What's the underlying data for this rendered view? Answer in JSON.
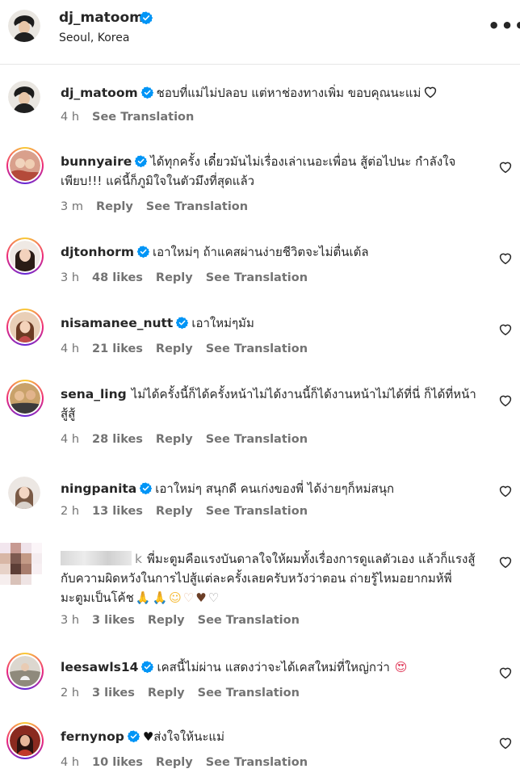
{
  "post": {
    "username": "dj_matoom",
    "location": "Seoul, Korea",
    "more_icon": "more-horizontal-icon"
  },
  "comments": [
    {
      "username": "dj_matoom",
      "text": "ชอบที่แม่ไม่ปลอบ แต่หาช่องทางเพิ่ม ขอบคุณนะแม่",
      "time": "4 h",
      "translate": "See Translation"
    },
    {
      "username": "bunnyaire",
      "text": "ได้ทุกครั้ง เดี๋ยวมันไม่เรื่องเล่าเนอะเพื่อน สู้ต่อไปนะ กำลังใจเพียบ!!! แค่นี้ก็ภูมิใจในตัวมึงที่สุดแล้ว",
      "time": "3 m",
      "reply": "Reply",
      "translate": "See Translation"
    },
    {
      "username": "djtonhorm",
      "text": "เอาใหม่ๆ ถ้าแคสผ่านง่ายชีวิตจะไม่ตื่นเต้ล",
      "time": "3 h",
      "likes": "48 likes",
      "reply": "Reply",
      "translate": "See Translation"
    },
    {
      "username": "nisamanee_nutt",
      "text": "เอาใหม่ๆมัม",
      "time": "4 h",
      "likes": "21 likes",
      "reply": "Reply",
      "translate": "See Translation"
    },
    {
      "username": "sena_ling",
      "text": "ไม่ได้ครั้งนี้ก็ได้ครั้งหน้าไม่ได้งานนี้ก็ได้งานหน้าไม่ได้ที่นี่ ก็ได้ที่หน้าสู้สู้",
      "time": "4 h",
      "likes": "28 likes",
      "reply": "Reply",
      "translate": "See Translation"
    },
    {
      "username": "ningpanita",
      "text": "เอาใหม่ๆ สนุกดี คนเก่งของพี่ ได้ง่ายๆก็หม่สนุก",
      "time": "2 h",
      "likes": "13 likes",
      "reply": "Reply",
      "translate": "See Translation"
    },
    {
      "username": "k",
      "text": "พี่มะตูมคือแรงบันดาลใจให้ผมทั้งเรื่องการดูแลตัวเอง แล้วก็แรงสู้กับความผิดหวังในการไปสู้แต่ละครั้งเลยครับหวังว่าตอน ถ่ายรู้ไหมอยากมห้พี่มะตูมเป็นโค้ช",
      "time": "3 h",
      "likes": "3 likes",
      "reply": "Reply",
      "translate": "See Translation"
    },
    {
      "username": "leesawls14",
      "text": "เคสนี้ไม่ผ่าน แสดงว่าจะได้เคสใหม่ที่ใหญ่กว่า",
      "time": "2 h",
      "likes": "3 likes",
      "reply": "Reply",
      "translate": "See Translation"
    },
    {
      "username": "fernynop",
      "text": "ส่งใจให้นะแม่",
      "time": "4 h",
      "likes": "10 likes",
      "reply": "Reply",
      "translate": "See Translation"
    }
  ],
  "colors": {
    "verified": "#0095f6",
    "muted": "#737373",
    "text": "#262626"
  }
}
